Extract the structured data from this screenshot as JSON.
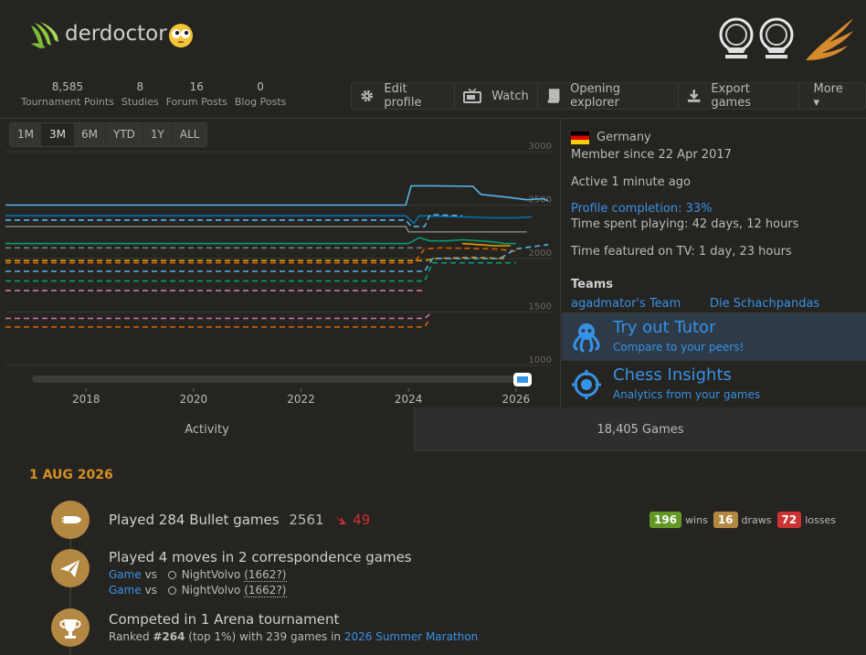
{
  "user": {
    "name": "derdoctor"
  },
  "stats": [
    {
      "num": "8,585",
      "label": "Tournament Points"
    },
    {
      "num": "8",
      "label": "Studies"
    },
    {
      "num": "16",
      "label": "Forum Posts"
    },
    {
      "num": "0",
      "label": "Blog Posts"
    }
  ],
  "actions": {
    "edit": "Edit profile",
    "watch": "Watch",
    "explorer": "Opening explorer",
    "export": "Export games",
    "more": "More ▾"
  },
  "ranges": [
    "1M",
    "3M",
    "6M",
    "YTD",
    "1Y",
    "ALL"
  ],
  "range_active": "3M",
  "chart_data": {
    "type": "line",
    "x_ticks": [
      "2018",
      "2020",
      "2022",
      "2024",
      "2026"
    ],
    "y_ticks": [
      "3000",
      "2500",
      "2000",
      "1500",
      "1000"
    ],
    "ylim": [
      1000,
      3000
    ],
    "xlim": [
      2016.5,
      2026.7
    ],
    "series": [
      {
        "color": "#56b4e9",
        "dash": false,
        "points": [
          [
            2016.5,
            2500
          ],
          [
            2023.95,
            2500
          ],
          [
            2024.05,
            2680
          ],
          [
            2024.5,
            2680
          ],
          [
            2025.2,
            2675
          ],
          [
            2025.35,
            2600
          ],
          [
            2025.9,
            2570
          ],
          [
            2026.2,
            2550
          ],
          [
            2026.5,
            2560
          ],
          [
            2026.6,
            2540
          ]
        ]
      },
      {
        "color": "#0072b2",
        "dash": false,
        "points": [
          [
            2016.5,
            2400
          ],
          [
            2023.95,
            2400
          ],
          [
            2024.1,
            2330
          ],
          [
            2024.2,
            2400
          ],
          [
            2025.0,
            2390
          ],
          [
            2025.6,
            2380
          ],
          [
            2026.0,
            2380
          ],
          [
            2026.3,
            2390
          ]
        ]
      },
      {
        "color": "#56b4e9",
        "dash": true,
        "points": [
          [
            2016.5,
            2360
          ],
          [
            2023.95,
            2360
          ],
          [
            2024.05,
            2300
          ],
          [
            2024.3,
            2300
          ],
          [
            2024.4,
            2410
          ],
          [
            2025.0,
            2400
          ]
        ]
      },
      {
        "color": "#7a7a7a",
        "dash": false,
        "points": [
          [
            2016.5,
            2300
          ],
          [
            2023.95,
            2300
          ],
          [
            2024.0,
            2250
          ],
          [
            2026.2,
            2250
          ]
        ]
      },
      {
        "color": "#009e73",
        "dash": false,
        "points": [
          [
            2016.5,
            2140
          ],
          [
            2024.0,
            2140
          ],
          [
            2024.2,
            2195
          ],
          [
            2024.4,
            2165
          ],
          [
            2024.7,
            2165
          ],
          [
            2025.0,
            2175
          ],
          [
            2025.5,
            2160
          ],
          [
            2025.8,
            2140
          ],
          [
            2026.0,
            2140
          ]
        ]
      },
      {
        "color": "#e69f00",
        "dash": false,
        "points": [
          [
            2025.0,
            2140
          ],
          [
            2025.6,
            2120
          ],
          [
            2025.9,
            2120
          ]
        ]
      },
      {
        "color": "#d55e00",
        "dash": true,
        "points": [
          [
            2016.5,
            1960
          ],
          [
            2024.1,
            1960
          ],
          [
            2024.3,
            2090
          ],
          [
            2024.6,
            2100
          ],
          [
            2025.6,
            2090
          ],
          [
            2026.0,
            2070
          ]
        ]
      },
      {
        "color": "#e69f00",
        "dash": true,
        "points": [
          [
            2016.5,
            1980
          ],
          [
            2024.3,
            1980
          ],
          [
            2024.5,
            2000
          ],
          [
            2025.2,
            2010
          ],
          [
            2025.8,
            2000
          ]
        ]
      },
      {
        "color": "#56b4e9",
        "dash": true,
        "points": [
          [
            2016.5,
            1880
          ],
          [
            2024.3,
            1880
          ],
          [
            2024.45,
            2000
          ],
          [
            2025.0,
            2000
          ],
          [
            2025.7,
            2000
          ],
          [
            2026.0,
            2090
          ],
          [
            2026.6,
            2130
          ]
        ]
      },
      {
        "color": "#009e73",
        "dash": true,
        "points": [
          [
            2016.5,
            1790
          ],
          [
            2024.3,
            1790
          ],
          [
            2024.45,
            1960
          ],
          [
            2025.5,
            1960
          ],
          [
            2026.0,
            1960
          ]
        ]
      },
      {
        "color": "#cc79a7",
        "dash": true,
        "points": [
          [
            2016.5,
            1440
          ],
          [
            2024.3,
            1440
          ],
          [
            2024.4,
            1480
          ]
        ]
      },
      {
        "color": "#d55e00",
        "dash": true,
        "points": [
          [
            2016.5,
            1360
          ],
          [
            2024.3,
            1360
          ],
          [
            2024.4,
            1440
          ]
        ]
      },
      {
        "color": "#cc79a7",
        "dash": true,
        "points": [
          [
            2016.5,
            1700
          ],
          [
            2024.3,
            1700
          ]
        ]
      },
      {
        "color": "#7a7a7a",
        "dash": true,
        "points": [
          [
            2016.5,
            2100
          ],
          [
            2024.3,
            2100
          ]
        ]
      }
    ]
  },
  "profile": {
    "country": "Germany",
    "member_since": "Member since 22 Apr 2017",
    "active": "Active 1 minute ago",
    "completion": "Profile completion: 33%",
    "time_playing": "Time spent playing: 42 days, 12 hours",
    "time_tv": "Time featured on TV: 1 day, 23 hours",
    "teams_heading": "Teams",
    "teams": [
      "agadmator's Team",
      "Die Schachpandas"
    ]
  },
  "promos": {
    "tutor_title": "Try out Tutor",
    "tutor_sub": "Compare to your peers!",
    "insights_title": "Chess Insights",
    "insights_sub": "Analytics from your games"
  },
  "tabs": {
    "activity": "Activity",
    "games": "18,405 Games"
  },
  "activity": {
    "date": "1 AUG 2026",
    "bullet": {
      "title": "Played 284 Bullet games",
      "rating": "2561",
      "change": "49",
      "wins": "196",
      "wins_label": "wins",
      "draws": "16",
      "draws_label": "draws",
      "losses": "72",
      "losses_label": "losses"
    },
    "corr": {
      "title": "Played 4 moves in 2 correspondence games",
      "games": [
        {
          "link": "Game",
          "vs": "vs",
          "opponent": "NightVolvo",
          "rating": "(1662?)"
        },
        {
          "link": "Game",
          "vs": "vs",
          "opponent": "NightVolvo",
          "rating": "(1662?)"
        }
      ]
    },
    "arena": {
      "title": "Competed in 1 Arena tournament",
      "ranked_prefix": "Ranked ",
      "rank": "#264",
      "ranked_mid": " (top 1%) with 239 games in ",
      "tournament": "2026 Summer Marathon"
    }
  },
  "colors": {
    "accent": "#3692e7",
    "gold": "#d59120",
    "win": "#629924",
    "draw": "#b38843",
    "loss": "#cc3333"
  }
}
